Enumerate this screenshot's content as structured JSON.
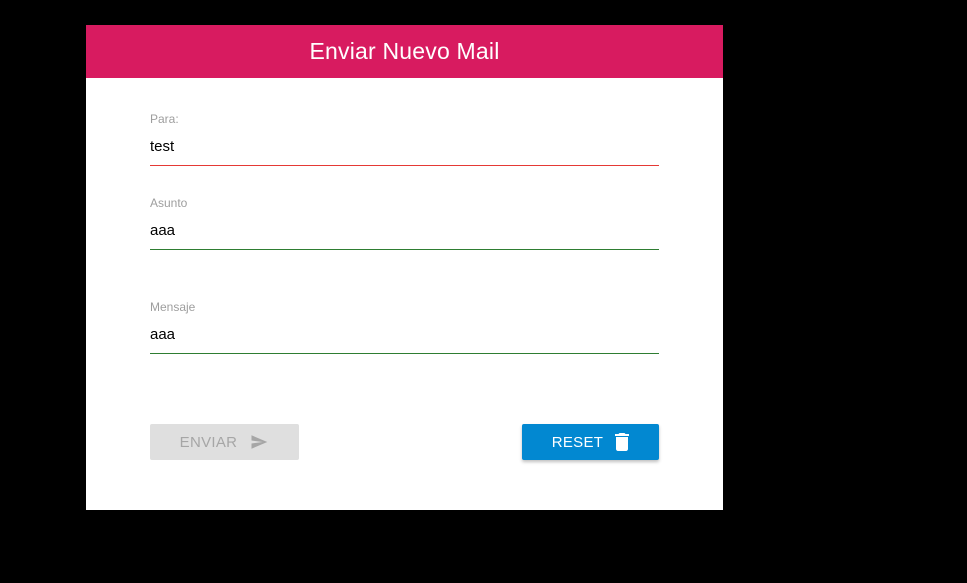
{
  "form": {
    "title": "Enviar Nuevo Mail",
    "fields": [
      {
        "label": "Para:",
        "value": "test",
        "state": "invalid"
      },
      {
        "label": "Asunto",
        "value": "aaa",
        "state": "valid"
      },
      {
        "label": "Mensaje",
        "value": "aaa",
        "state": "valid"
      }
    ],
    "send_button": {
      "label": "ENVIAR",
      "icon": "send-icon",
      "disabled": true
    },
    "reset_button": {
      "label": "RESET",
      "icon": "trash-icon"
    }
  },
  "colors": {
    "header": "#d81b60",
    "valid": "#2e7d32",
    "invalid": "#e53935",
    "reset": "#0288d1",
    "disabled": "#dfdfdf"
  }
}
